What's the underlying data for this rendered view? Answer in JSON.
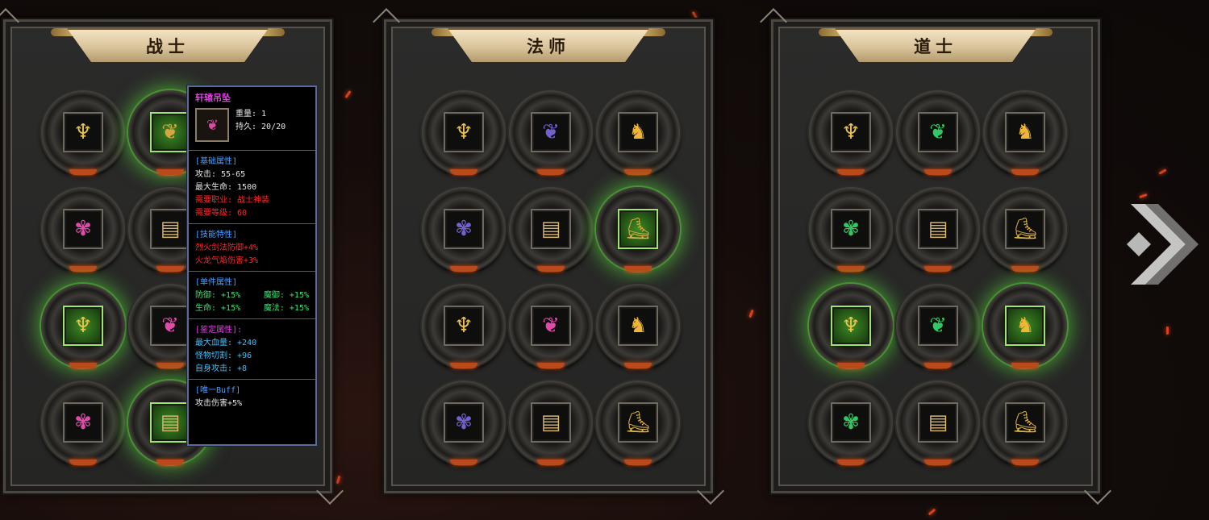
{
  "panels": [
    {
      "title": "战士",
      "slots": [
        {
          "icon": "armor-icon",
          "glyph": "♆",
          "cls": "c-armor",
          "glow": false
        },
        {
          "icon": "necklace-icon",
          "glyph": "❦",
          "cls": "c-neck",
          "glow": true
        },
        {
          "icon": "ring-icon",
          "glyph": "✾",
          "cls": "c-ring",
          "glow": false
        },
        {
          "icon": "belt-icon",
          "glyph": "▤",
          "cls": "c-belt",
          "glow": false
        },
        {
          "icon": "armor-icon",
          "glyph": "♆",
          "cls": "c-armor",
          "glow": true
        },
        {
          "icon": "necklace-icon",
          "glyph": "❦",
          "cls": "c-ring",
          "glow": false
        },
        {
          "icon": "ring-icon",
          "glyph": "✾",
          "cls": "c-ring",
          "glow": false
        },
        {
          "icon": "belt-icon",
          "glyph": "▤",
          "cls": "c-belt",
          "glow": true
        }
      ]
    },
    {
      "title": "法师",
      "slots": [
        {
          "icon": "armor-icon",
          "glyph": "♆",
          "cls": "c-armor",
          "glow": false
        },
        {
          "icon": "necklace-icon",
          "glyph": "❦",
          "cls": "c-gem-blue",
          "glow": false
        },
        {
          "icon": "helmet-icon",
          "glyph": "♞",
          "cls": "c-helm",
          "glow": false
        },
        {
          "icon": "ring-icon",
          "glyph": "✾",
          "cls": "c-gem-blue",
          "glow": false
        },
        {
          "icon": "belt-icon",
          "glyph": "▤",
          "cls": "c-belt",
          "glow": false
        },
        {
          "icon": "boots-icon",
          "glyph": "⛸",
          "cls": "c-boot",
          "glow": true
        },
        {
          "icon": "armor-icon",
          "glyph": "♆",
          "cls": "c-armor",
          "glow": false
        },
        {
          "icon": "necklace-icon",
          "glyph": "❦",
          "cls": "c-ring",
          "glow": false
        },
        {
          "icon": "helmet-icon",
          "glyph": "♞",
          "cls": "c-helm",
          "glow": false
        },
        {
          "icon": "ring-icon",
          "glyph": "✾",
          "cls": "c-gem-blue",
          "glow": false
        },
        {
          "icon": "belt-icon",
          "glyph": "▤",
          "cls": "c-belt",
          "glow": false
        },
        {
          "icon": "boots-icon",
          "glyph": "⛸",
          "cls": "c-boot",
          "glow": false
        }
      ]
    },
    {
      "title": "道士",
      "slots": [
        {
          "icon": "armor-icon",
          "glyph": "♆",
          "cls": "c-armor",
          "glow": false
        },
        {
          "icon": "necklace-icon",
          "glyph": "❦",
          "cls": "c-gem-green",
          "glow": false
        },
        {
          "icon": "helmet-icon",
          "glyph": "♞",
          "cls": "c-helm",
          "glow": false
        },
        {
          "icon": "ring-icon",
          "glyph": "✾",
          "cls": "c-gem-green",
          "glow": false
        },
        {
          "icon": "belt-icon",
          "glyph": "▤",
          "cls": "c-belt",
          "glow": false
        },
        {
          "icon": "boots-icon",
          "glyph": "⛸",
          "cls": "c-boot",
          "glow": false
        },
        {
          "icon": "armor-icon",
          "glyph": "♆",
          "cls": "c-armor",
          "glow": true
        },
        {
          "icon": "necklace-icon",
          "glyph": "❦",
          "cls": "c-gem-green",
          "glow": false
        },
        {
          "icon": "helmet-icon",
          "glyph": "♞",
          "cls": "c-helm",
          "glow": true
        },
        {
          "icon": "ring-icon",
          "glyph": "✾",
          "cls": "c-gem-green",
          "glow": false
        },
        {
          "icon": "belt-icon",
          "glyph": "▤",
          "cls": "c-belt",
          "glow": false
        },
        {
          "icon": "boots-icon",
          "glyph": "⛸",
          "cls": "c-boot",
          "glow": false
        }
      ]
    }
  ],
  "tooltip": {
    "name": "轩辕吊坠",
    "icon": "necklace-icon",
    "weight": "重量: 1",
    "durability": "持久: 20/20",
    "basic_head": "[基础属性]",
    "attack": "攻击: 55-65",
    "max_hp": "最大生命: 1500",
    "req_class": "需要职业: 战士神装",
    "req_level": "需要等级: 60",
    "skill_head": "[技能特性]",
    "skill1": "烈火剑法防御+4%",
    "skill2": "火龙气焰伤害+3%",
    "single_head": "[单件属性]",
    "def": "防御: +15%",
    "mdef": "魔御: +15%",
    "hp": "生命: +15%",
    "mp": "魔法: +15%",
    "appraise_head": "[鉴定属性]:",
    "ap1": "最大血量: +240",
    "ap2": "怪物切割: +96",
    "ap3": "自身攻击: +8",
    "buff_head": "[唯一Buff]",
    "buff1": "攻击伤害+5%"
  },
  "colors": {
    "accent": "#e040e0",
    "glow": "#5adc3c",
    "ember": "#ff4a1a"
  }
}
